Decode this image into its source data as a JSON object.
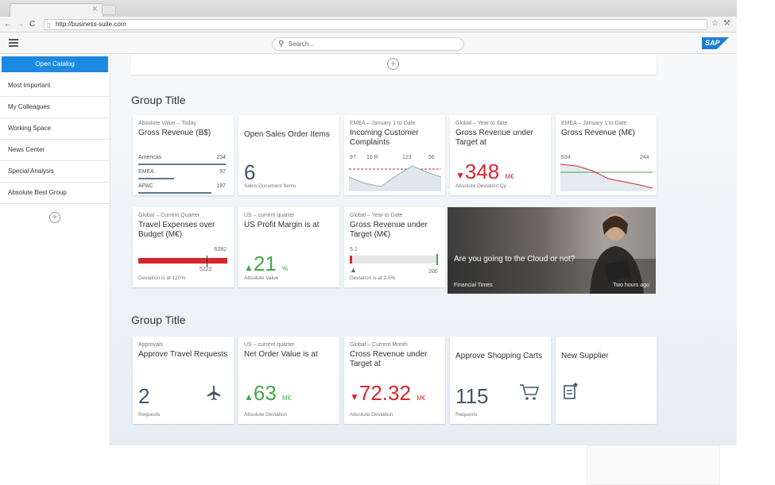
{
  "browser": {
    "url": "http://business-suite.com"
  },
  "shell": {
    "search_placeholder": "Search...",
    "logo": "SAP"
  },
  "sidebar": {
    "open_catalog": "Open Catalog",
    "items": [
      "Most Important",
      "My Colleagues",
      "Working Space",
      "News Center",
      "Special Analysis",
      "Absolute Best Group"
    ]
  },
  "groups": [
    {
      "title": "Group Title"
    },
    {
      "title": "Group Title"
    }
  ],
  "tiles": {
    "gross_bs": {
      "subtitle": "Absolute Value – Today",
      "title": "Gross Revenue (B$)",
      "rows": [
        {
          "label": "Americas",
          "value": "234",
          "fraction": 1.0
        },
        {
          "label": "EMEA",
          "value": "97",
          "fraction": 0.41
        },
        {
          "label": "APAC",
          "value": "197",
          "fraction": 0.84
        }
      ]
    },
    "open_sales": {
      "title": "Open Sales Order Items",
      "value": "6",
      "footer": "Sales Document Items"
    },
    "complaints": {
      "subtitle": "EMEA – January 1 to Date",
      "title": "Incoming Customer Complaints",
      "labels": [
        "97",
        "16 R",
        "123",
        "56"
      ]
    },
    "gross_under_target": {
      "subtitle": "Global – Year to date",
      "title": "Gross Revenue under Target at",
      "value": "348",
      "unit": "M€",
      "arrow": "▼",
      "footer": "Absolute Deviation Çy"
    },
    "gross_me": {
      "subtitle": "EMEA – January 1 to Date",
      "title": "Gross Revenue (M€)",
      "left_label": "634",
      "right_label": "244"
    },
    "travel": {
      "subtitle": "Global – Current Quarter",
      "title": "Travel Expenses over Budget (M€)",
      "actual": "6282",
      "target": "5222",
      "footer": "Deviation is at 120%"
    },
    "profit_margin": {
      "subtitle": "US – current quarter",
      "title": "US Profit Margin is at",
      "value": "21",
      "unit": "%",
      "arrow": "▲",
      "footer": "Absolute Value"
    },
    "gross_target_me": {
      "subtitle": "Global – Year to Date",
      "title": "Gross Revenue under Target (M€)",
      "value": "5.1",
      "max": "200",
      "warn": "▲",
      "fraction": 0.025,
      "footer": "Deviation is at 2.5%"
    },
    "news": {
      "headline": "Are you going to the Cloud or not?",
      "source": "Financial Times",
      "time": "Two hours ago"
    },
    "approvals": {
      "subtitle": "Approvals",
      "title": "Approve Travel Requests",
      "value": "2",
      "footer": "Requests"
    },
    "net_order": {
      "subtitle": "US – current quarter",
      "title": "Net Order Value is at",
      "value": "63",
      "unit": "M€",
      "arrow": "▲",
      "footer": "Absolute Deviation"
    },
    "cross_revenue": {
      "subtitle": "Global – Current Month",
      "title": "Cross Revenue under Target at",
      "value": "72.32",
      "unit": "M€",
      "arrow": "▼",
      "footer": "Absolute Deviation"
    },
    "shopping": {
      "title": "Approve Shopping Carts",
      "value": "115",
      "footer": "Requests"
    },
    "new_supplier": {
      "title": "New Supplier"
    }
  },
  "colors": {
    "accent": "#1b8ae0",
    "positive": "#4aa64a",
    "negative": "#d7262c",
    "value": "#41556b"
  },
  "icons": [
    "airplane-icon",
    "shopping-cart-icon",
    "new-document-icon",
    "plus-circle-icon",
    "search-icon",
    "menu-icon"
  ]
}
